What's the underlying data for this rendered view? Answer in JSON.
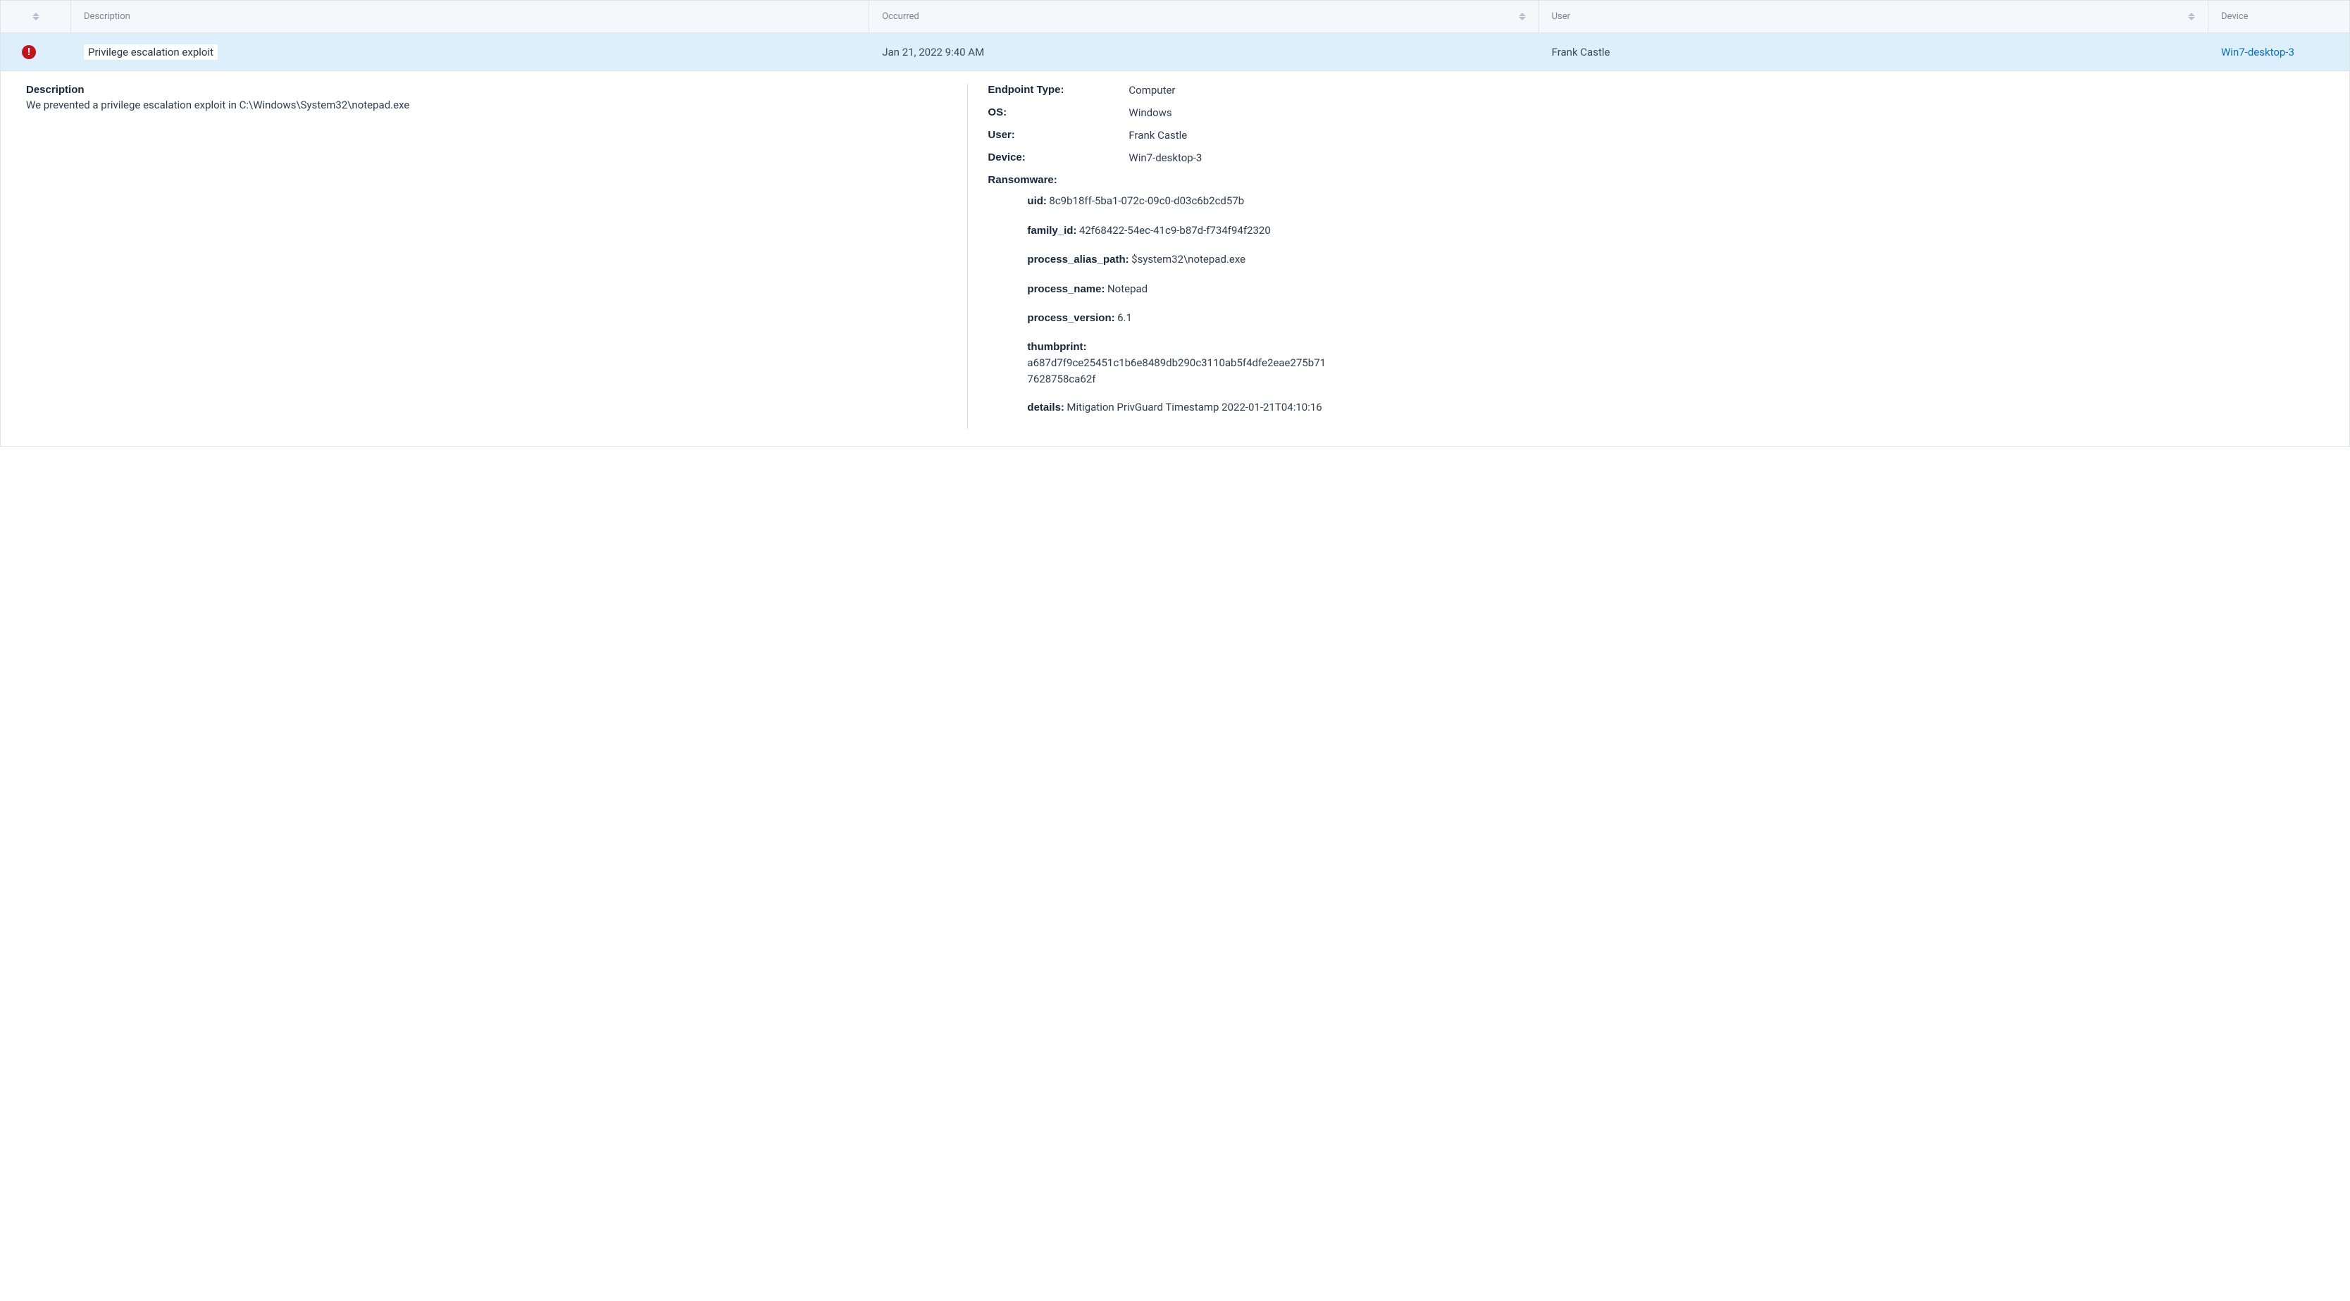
{
  "headers": {
    "description": "Description",
    "occurred": "Occurred",
    "user": "User",
    "device": "Device"
  },
  "row": {
    "severity_icon": "alert-critical",
    "description": "Privilege escalation exploit",
    "occurred": "Jan 21, 2022 9:40 AM",
    "user": "Frank Castle",
    "device": "Win7-desktop-3"
  },
  "detail": {
    "description_label": "Description",
    "description_body": "We prevented a privilege escalation exploit in C:\\Windows\\System32\\notepad.exe",
    "endpoint_type_label": "Endpoint Type:",
    "endpoint_type": "Computer",
    "os_label": "OS:",
    "os": "Windows",
    "user_label": "User:",
    "user": "Frank Castle",
    "device_label": "Device:",
    "device": "Win7-desktop-3",
    "ransomware_label": "Ransomware:",
    "ransomware": {
      "uid_label": "uid:",
      "uid": "8c9b18ff-5ba1-072c-09c0-d03c6b2cd57b",
      "family_id_label": "family_id:",
      "family_id": "42f68422-54ec-41c9-b87d-f734f94f2320",
      "process_alias_path_label": "process_alias_path:",
      "process_alias_path": "$system32\\notepad.exe",
      "process_name_label": "process_name:",
      "process_name": "Notepad",
      "process_version_label": "process_version:",
      "process_version": "6.1",
      "thumbprint_label": "thumbprint:",
      "thumbprint": "a687d7f9ce25451c1b6e8489db290c3110ab5f4dfe2eae275b717628758ca62f",
      "details_label": "details:",
      "details": "Mitigation   PrivGuard   Timestamp    2022-01-21T04:10:16"
    }
  }
}
